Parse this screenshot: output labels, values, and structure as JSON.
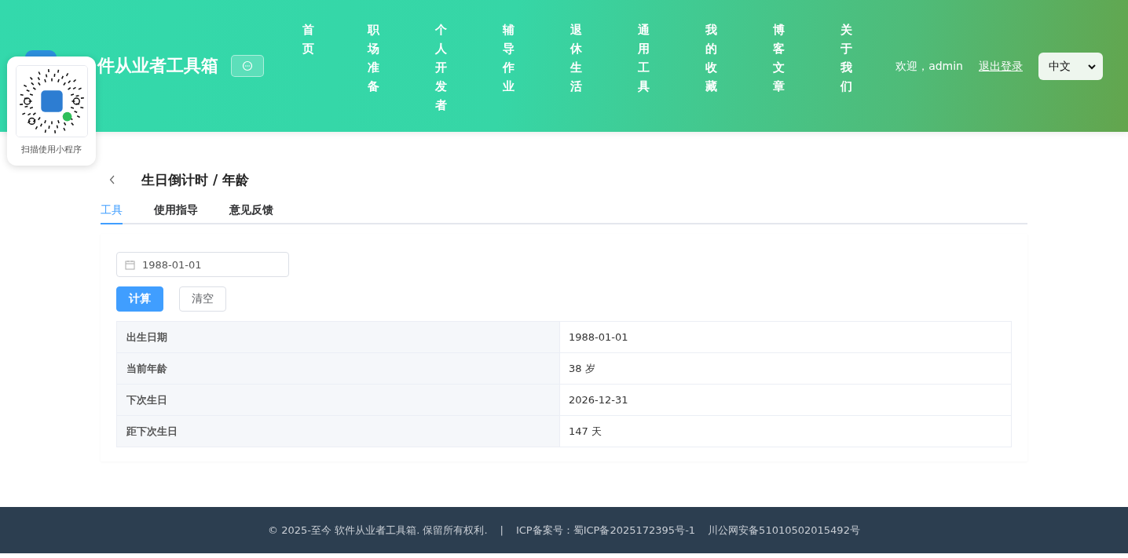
{
  "header": {
    "title": "件从业者工具箱",
    "nav": [
      {
        "label": "首页"
      },
      {
        "label": "职场准备"
      },
      {
        "label": "个人开发者"
      },
      {
        "label": "辅导作业"
      },
      {
        "label": "退休生活"
      },
      {
        "label": "通用工具"
      },
      {
        "label": "我的收藏"
      },
      {
        "label": "博客文章"
      },
      {
        "label": "关于我们"
      }
    ],
    "welcome": "欢迎，admin",
    "logout": "退出登录",
    "language": "中文"
  },
  "qr_popup": {
    "caption": "扫描使用小程序"
  },
  "page": {
    "title": "生日倒计时 / 年龄",
    "tabs": [
      {
        "label": "工具",
        "selected": true
      },
      {
        "label": "使用指导",
        "selected": false
      },
      {
        "label": "意见反馈",
        "selected": false
      }
    ],
    "date_field": {
      "value": "1988-01-01"
    },
    "buttons": [
      {
        "label": "计算",
        "kind": "primary"
      },
      {
        "label": "清空",
        "kind": "plain"
      }
    ],
    "results": [
      {
        "label": "出生日期",
        "value": "1988-01-01"
      },
      {
        "label": "当前年龄",
        "value": "38 岁"
      },
      {
        "label": "下次生日",
        "value": "2026-12-31"
      },
      {
        "label": "距下次生日",
        "value": "147 天"
      }
    ]
  },
  "footer": {
    "copyright": "© 2025-至今 软件从业者工具箱. 保留所有权利.",
    "separator": "|",
    "icp": "ICP备案号：蜀ICP备2025172395号-1",
    "police": "川公网安备51010502015492号"
  }
}
